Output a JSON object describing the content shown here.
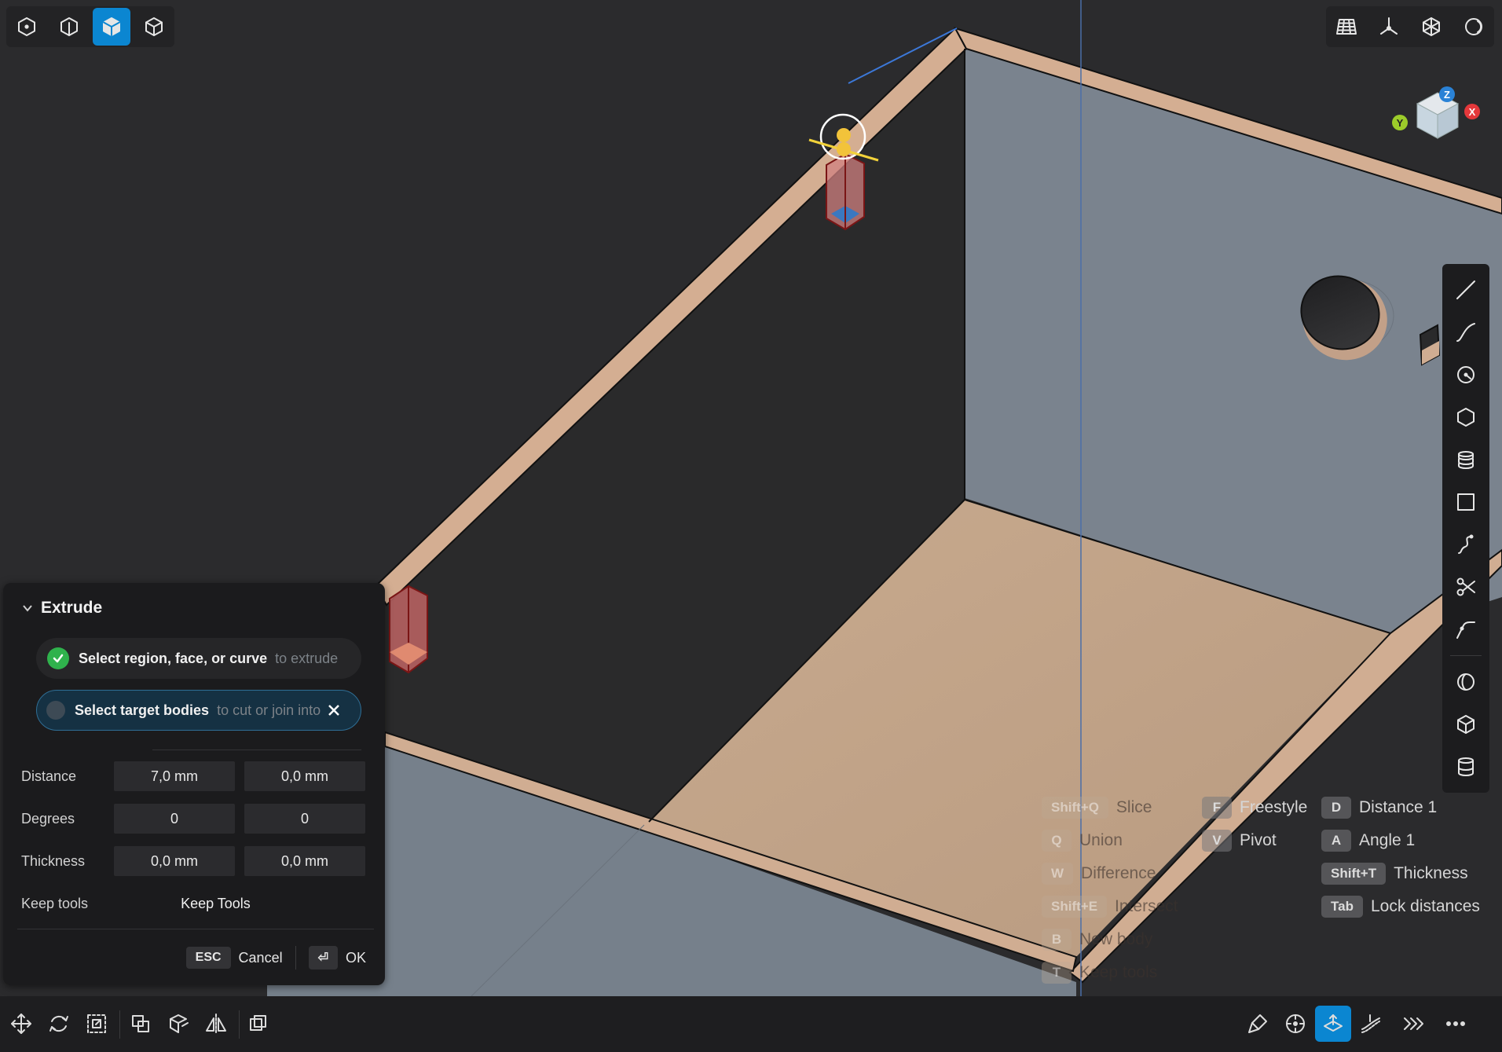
{
  "toolbar_top_left": {
    "items": [
      {
        "name": "view-mode-1-icon"
      },
      {
        "name": "view-mode-2-icon"
      },
      {
        "name": "view-mode-3-icon",
        "active": true
      },
      {
        "name": "view-mode-4-icon"
      }
    ]
  },
  "toolbar_top_right": {
    "items": [
      {
        "name": "grid-icon"
      },
      {
        "name": "axes-icon"
      },
      {
        "name": "wireframe-icon"
      },
      {
        "name": "render-mode-icon"
      }
    ]
  },
  "nav_cube": {
    "axis_x": "X",
    "axis_y": "Y",
    "axis_z": "Z"
  },
  "extrude_panel": {
    "title": "Extrude",
    "select_region": {
      "label": "Select region, face, or curve",
      "hint": "to extrude",
      "done": true
    },
    "select_targets": {
      "label": "Select target bodies",
      "hint": "to cut or join into",
      "done": false
    },
    "distance": {
      "label": "Distance",
      "value1": "7,0 mm",
      "value2": "0,0 mm"
    },
    "degrees": {
      "label": "Degrees",
      "value1": "0",
      "value2": "0"
    },
    "thickness": {
      "label": "Thickness",
      "value1": "0,0 mm",
      "value2": "0,0 mm"
    },
    "keep_tools": {
      "label": "Keep tools",
      "value": "Keep Tools"
    },
    "cancel": {
      "key": "ESC",
      "label": "Cancel"
    },
    "ok": {
      "key": "⏎",
      "label": "OK"
    }
  },
  "shortcuts": [
    {
      "key": "Shift+Q",
      "label": "Slice",
      "dim": true
    },
    {
      "key": "Q",
      "label": "Union",
      "dim": true
    },
    {
      "key": "W",
      "label": "Difference",
      "dim": true
    },
    {
      "key": "Shift+E",
      "label": "Intersect",
      "dim": true
    },
    {
      "key": "B",
      "label": "New body",
      "dim": true
    },
    {
      "key": "T",
      "label": "Keep tools",
      "dim": true
    },
    {
      "key": "F",
      "label": "Freestyle",
      "dim": false
    },
    {
      "key": "V",
      "label": "Pivot",
      "dim": false
    },
    {
      "key": "D",
      "label": "Distance 1",
      "dim": false
    },
    {
      "key": "A",
      "label": "Angle 1",
      "dim": false
    },
    {
      "key": "Shift+T",
      "label": "Thickness",
      "dim": false
    },
    {
      "key": "Tab",
      "label": "Lock distances",
      "dim": false
    }
  ],
  "colors": {
    "accent": "#0b86d1",
    "panel_bg": "#1b1b1d",
    "wall_dark": "#2a2a2b",
    "wall_light": "#76808b",
    "wood_edge": "#d2ac90",
    "floor": "#c5a78b"
  }
}
